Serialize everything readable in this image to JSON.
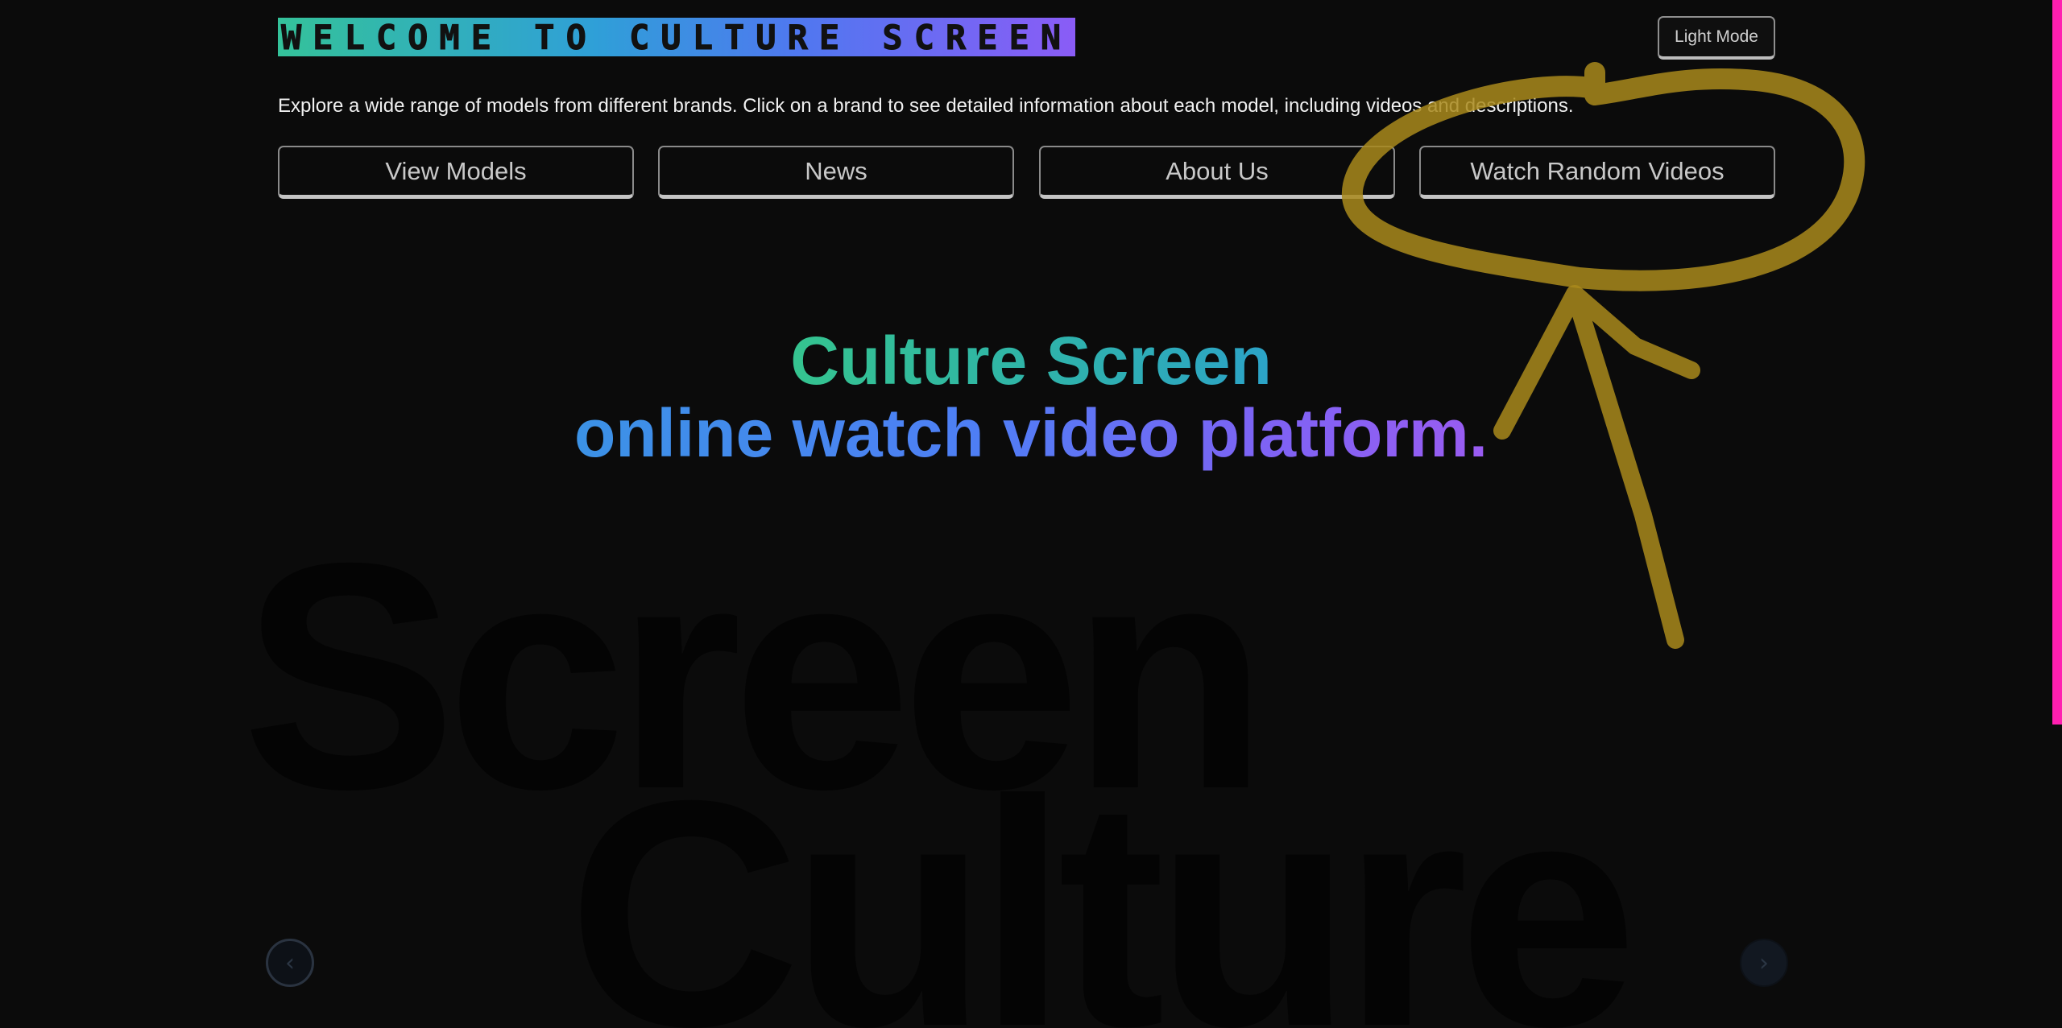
{
  "header": {
    "site_title": "WELCOME TO CULTURE SCREEN",
    "mode_toggle_label": "Light Mode",
    "intro": "Explore a wide range of models from different brands. Click on a brand to see detailed information about each model, including videos and descriptions."
  },
  "nav": {
    "items": [
      {
        "label": "View Models"
      },
      {
        "label": "News"
      },
      {
        "label": "About Us"
      },
      {
        "label": "Watch Random Videos"
      }
    ]
  },
  "hero": {
    "line1": "Culture Screen",
    "line2": "online watch video platform."
  },
  "background_words": {
    "word1": "Screen",
    "word2": "Culture"
  },
  "carousel": {
    "prev_icon": "chevron-left-icon",
    "next_icon": "chevron-right-icon"
  },
  "colors": {
    "background": "#0b0b0b",
    "gradient_green": "#35c48f",
    "gradient_blue": "#4f7ef5",
    "gradient_purple": "#9a5cf2",
    "annotation": "#a98a1c",
    "scrollbar": "#ff1fb0"
  }
}
